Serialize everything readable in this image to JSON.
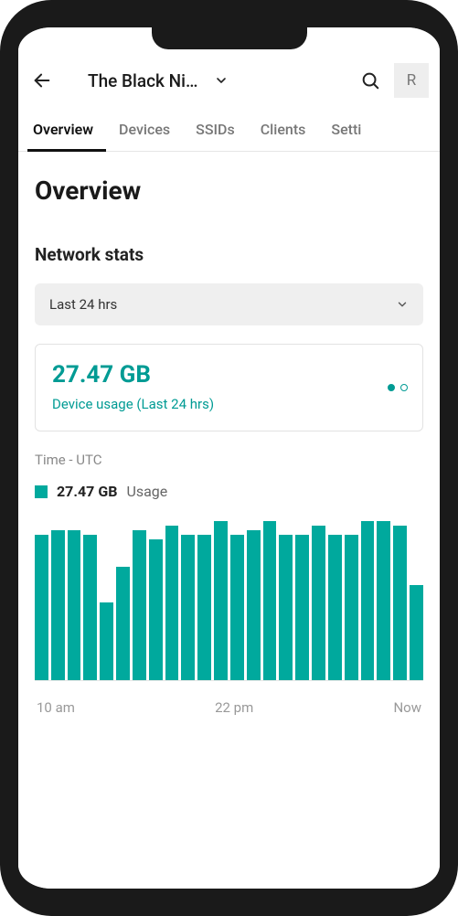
{
  "header": {
    "title": "The Black Ni…",
    "avatar_initial": "R"
  },
  "tabs": [
    {
      "label": "Overview",
      "active": true
    },
    {
      "label": "Devices",
      "active": false
    },
    {
      "label": "SSIDs",
      "active": false
    },
    {
      "label": "Clients",
      "active": false
    },
    {
      "label": "Setti",
      "active": false
    }
  ],
  "page": {
    "heading": "Overview",
    "section": "Network stats",
    "range_selected": "Last 24 hrs"
  },
  "stat_card": {
    "value": "27.47 GB",
    "subtitle": "Device usage (Last 24 hrs)"
  },
  "chart_meta": {
    "timezone_label": "Time - UTC",
    "legend_value": "27.47 GB",
    "legend_name": "Usage"
  },
  "chart_data": {
    "type": "bar",
    "title": "Usage",
    "xlabel": "Time - UTC",
    "ylabel": "",
    "categories": [
      "10 am",
      "",
      "",
      "",
      "",
      "",
      "",
      "",
      "",
      "",
      "",
      "",
      "22 pm",
      "",
      "",
      "",
      "",
      "",
      "",
      "",
      "",
      "",
      "",
      "Now"
    ],
    "x_tick_labels": [
      "10 am",
      "22 pm",
      "Now"
    ],
    "values": [
      160,
      165,
      165,
      160,
      85,
      125,
      165,
      155,
      170,
      160,
      160,
      175,
      160,
      165,
      175,
      160,
      160,
      170,
      160,
      160,
      175,
      175,
      170,
      105
    ],
    "ylim": [
      0,
      180
    ],
    "color": "#00a99d"
  }
}
